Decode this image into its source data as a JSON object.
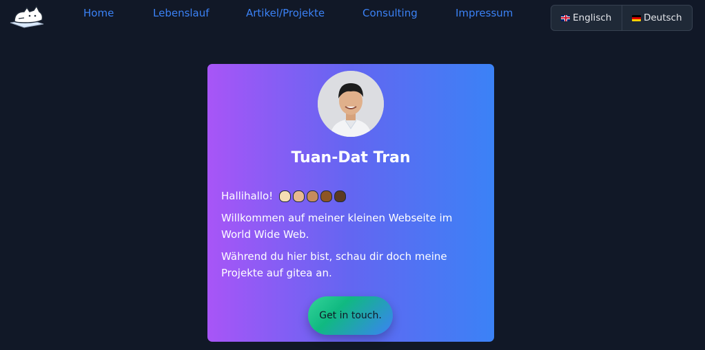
{
  "nav": {
    "items": [
      {
        "label": "Home"
      },
      {
        "label": "Lebenslauf"
      },
      {
        "label": "Artikel/Projekte"
      },
      {
        "label": "Consulting"
      },
      {
        "label": "Impressum"
      }
    ],
    "link_color": "#3b82f6"
  },
  "language": {
    "english": {
      "label": "Englisch",
      "flag": "uk-flag-icon"
    },
    "german": {
      "label": "Deutsch",
      "flag": "german-flag-icon"
    }
  },
  "profile": {
    "name": "Tuan-Dat Tran",
    "greeting": "Hallihallo!",
    "greeting_emojis": [
      "waving-hand-light-icon",
      "waving-hand-medium-light-icon",
      "waving-hand-medium-icon",
      "waving-hand-medium-dark-icon",
      "waving-hand-dark-icon"
    ],
    "paragraph_1": "Willkommen auf meiner kleinen Webseite im World Wide Web.",
    "paragraph_2": "Während du hier bist, schau dir doch meine Projekte auf gitea an.",
    "cta_label": "Get in touch."
  },
  "colors": {
    "background": "#111827",
    "card_gradient_start": "#a855f7",
    "card_gradient_end": "#3b82f6"
  }
}
